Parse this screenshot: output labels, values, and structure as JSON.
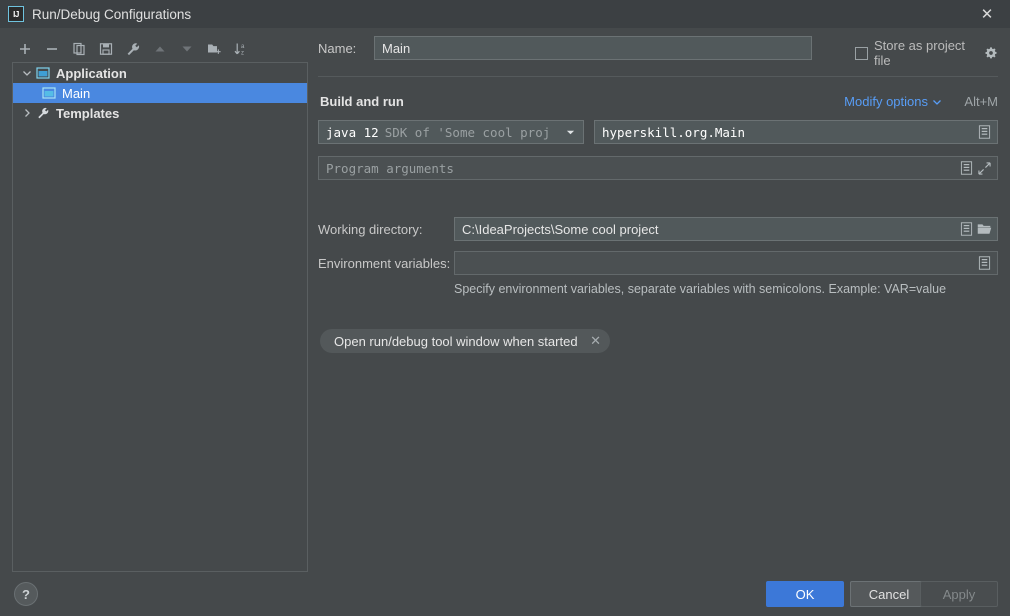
{
  "window": {
    "title": "Run/Debug Configurations",
    "app_icon": "intellij-idea-icon",
    "app_icon_text": "IJ",
    "close_icon": "close-icon",
    "close_glyph": "✕"
  },
  "toolbar": {
    "buttons": [
      {
        "name": "add-configuration-button",
        "icon": "plus-icon",
        "tooltip": "Add New Configuration",
        "enabled": true
      },
      {
        "name": "remove-configuration-button",
        "icon": "minus-icon",
        "tooltip": "Remove Configuration",
        "enabled": true
      },
      {
        "name": "copy-configuration-button",
        "icon": "copy-icon",
        "tooltip": "Copy Configuration",
        "enabled": true
      },
      {
        "name": "save-configuration-button",
        "icon": "save-icon",
        "tooltip": "Save Configuration",
        "enabled": true
      },
      {
        "name": "edit-templates-button",
        "icon": "wrench-icon",
        "tooltip": "Edit Templates",
        "enabled": true
      },
      {
        "name": "move-up-button",
        "icon": "arrow-up-icon",
        "tooltip": "Move Up",
        "enabled": false
      },
      {
        "name": "move-down-button",
        "icon": "arrow-down-icon",
        "tooltip": "Move Down",
        "enabled": false
      },
      {
        "name": "create-folder-button",
        "icon": "folder-add-icon",
        "tooltip": "Create New Folder",
        "enabled": true
      },
      {
        "name": "sort-configurations-button",
        "icon": "sort-alphabetical-icon",
        "tooltip": "Sort Configurations",
        "enabled": true
      }
    ]
  },
  "tree": {
    "nodes": [
      {
        "name": "tree-node-application",
        "label": "Application",
        "icon": "application-window-icon",
        "expanded": true,
        "arrow": "⌄",
        "selected": false,
        "bold": true,
        "level": 0
      },
      {
        "name": "tree-node-main",
        "label": "Main",
        "icon": "application-window-icon",
        "expanded": null,
        "arrow": "",
        "selected": true,
        "bold": false,
        "level": 1
      },
      {
        "name": "tree-node-templates",
        "label": "Templates",
        "icon": "wrench-icon",
        "expanded": false,
        "arrow": "›",
        "selected": false,
        "bold": true,
        "level": 0
      }
    ]
  },
  "form": {
    "name_label": "Name:",
    "name_value": "Main",
    "store_as_project_file_label": "Store as project file",
    "store_as_project_file_checked": false,
    "store_gear_icon": "gear-icon",
    "section_title": "Build and run",
    "modify_options_label": "Modify options",
    "modify_options_chevron": "⌄",
    "modify_options_shortcut": "Alt+M",
    "sdk_value_bright": "java 12",
    "sdk_value_dim": "SDK of 'Some cool proj",
    "sdk_dropdown_icon": "chevron-down-icon",
    "main_class_value": "hyperskill.org.Main",
    "main_class_macro_icon": "macro-list-icon",
    "program_arguments_placeholder": "Program arguments",
    "program_arguments_value": "",
    "program_arguments_macro_icon": "macro-list-icon",
    "program_arguments_expand_icon": "expand-icon",
    "working_directory_label": "Working directory:",
    "working_directory_value": "C:\\IdeaProjects\\Some cool project",
    "working_directory_macro_icon": "macro-list-icon",
    "working_directory_browse_icon": "folder-open-icon",
    "environment_variables_label": "Environment variables:",
    "environment_variables_value": "",
    "environment_variables_macro_icon": "macro-list-icon",
    "environment_variables_hint": "Specify environment variables, separate variables with semicolons. Example: VAR=value",
    "option_chip_label": "Open run/debug tool window when started",
    "option_chip_close_icon": "close-icon",
    "option_chip_close_glyph": "✕"
  },
  "footer": {
    "help_label": "?",
    "help_icon": "help-icon",
    "ok_label": "OK",
    "cancel_label": "Cancel",
    "apply_label": "Apply",
    "apply_enabled": false
  },
  "colors": {
    "dialog_background": "#45494b",
    "titlebar_background": "#3c4043",
    "selection_blue": "#4a88e0",
    "link_blue": "#589df6",
    "ok_button_blue": "#3c78d8",
    "icon_cyan": "#6fc3df",
    "field_background": "#51595b",
    "text_primary": "#e4e4e4",
    "text_dim": "#9aa0a2"
  }
}
